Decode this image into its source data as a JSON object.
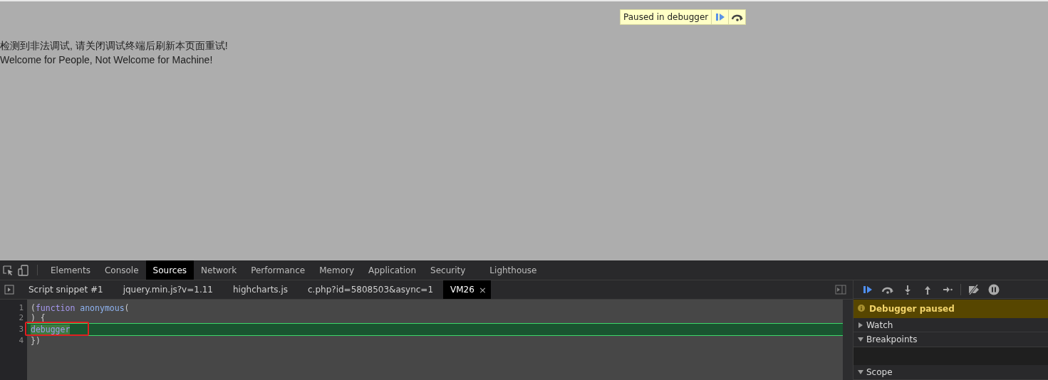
{
  "page": {
    "paused_banner": {
      "text": "Paused in debugger"
    },
    "messages": [
      "检测到非法调试, 请关闭调试终端后刷新本页面重试!",
      "Welcome for People, Not Welcome for Machine!"
    ]
  },
  "devtools": {
    "tabs": [
      {
        "label": "Elements",
        "selected": false
      },
      {
        "label": "Console",
        "selected": false
      },
      {
        "label": "Sources",
        "selected": true
      },
      {
        "label": "Network",
        "selected": false
      },
      {
        "label": "Performance",
        "selected": false
      },
      {
        "label": "Memory",
        "selected": false
      },
      {
        "label": "Application",
        "selected": false
      },
      {
        "label": "Security",
        "selected": false
      },
      {
        "label": "Lighthouse",
        "selected": false
      }
    ],
    "file_tabs": [
      {
        "label": "Script snippet #1",
        "selected": false,
        "closable": false
      },
      {
        "label": "jquery.min.js?v=1.11",
        "selected": false,
        "closable": false
      },
      {
        "label": "highcharts.js",
        "selected": false,
        "closable": false
      },
      {
        "label": "c.php?id=5808503&async=1",
        "selected": false,
        "closable": false
      },
      {
        "label": "VM26",
        "selected": true,
        "closable": true
      }
    ],
    "close_glyph": "×",
    "code_lines": [
      {
        "number": "1",
        "current": false,
        "annotated": false,
        "text": "(**function** *anonymous*("
      },
      {
        "number": "2",
        "current": false,
        "annotated": false,
        "text": ") {"
      },
      {
        "number": "3",
        "current": true,
        "annotated": true,
        "text": "**debugger**"
      },
      {
        "number": "4",
        "current": false,
        "annotated": false,
        "text": "})"
      }
    ],
    "debugger_status": "Debugger paused",
    "panes": [
      {
        "label": "Watch",
        "expanded": false
      },
      {
        "label": "Breakpoints",
        "expanded": true
      },
      {
        "label": "Scope",
        "expanded": true
      }
    ]
  }
}
